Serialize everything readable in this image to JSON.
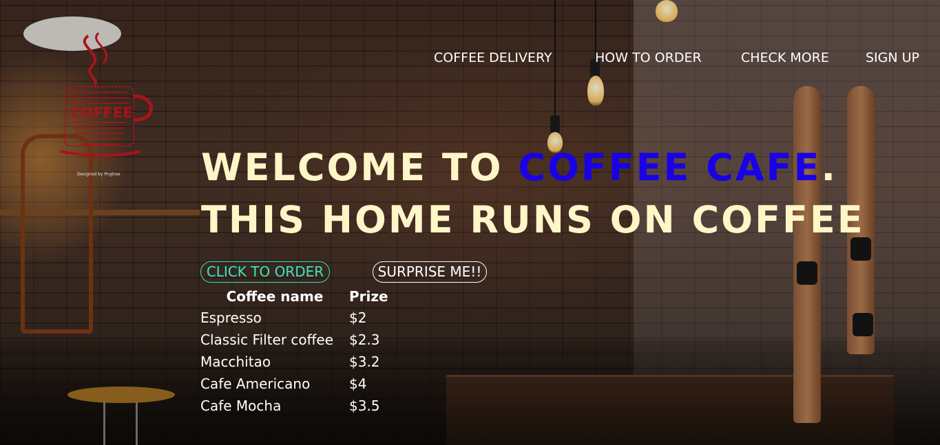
{
  "logo": {
    "text": "COFFEE",
    "caption": "Designed by Pngtree",
    "icon": "coffee-cup-logo-icon",
    "color": "#a8141c"
  },
  "nav": {
    "items": [
      {
        "label": "COFFEE DELIVERY"
      },
      {
        "label": "HOW TO ORDER"
      },
      {
        "label": "CHECK MORE"
      },
      {
        "label": "SIGN UP"
      }
    ]
  },
  "hero": {
    "line1_prefix": "WELCOME TO ",
    "line1_accent": "COFFEE CAFE",
    "line1_suffix": ".",
    "line2": "THIS HOME RUNS ON COFFEE",
    "text_color": "#fff6c8",
    "accent_color": "#1a00e6"
  },
  "buttons": {
    "order_label": "CLICK TO ORDER",
    "surprise_label": "SURPRISE ME!!",
    "order_color": "#3fe5bd"
  },
  "menu": {
    "headers": {
      "name": "Coffee name",
      "price": "Prize"
    },
    "rows": [
      {
        "name": "Espresso",
        "price": "$2"
      },
      {
        "name": "Classic Filter coffee",
        "price": "$2.3"
      },
      {
        "name": "Macchitao",
        "price": "$3.2"
      },
      {
        "name": "Cafe Americano",
        "price": "$4"
      },
      {
        "name": "Cafe Mocha",
        "price": "$3.5"
      }
    ]
  }
}
